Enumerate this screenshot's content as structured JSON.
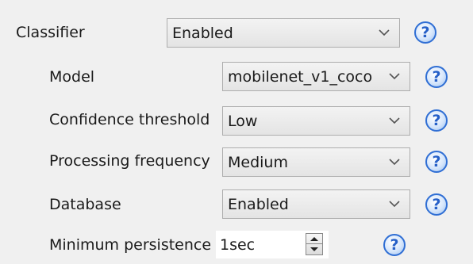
{
  "classifier": {
    "label": "Classifier",
    "value": "Enabled",
    "help": "?"
  },
  "model": {
    "label": "Model",
    "value": "mobilenet_v1_coco",
    "help": "?"
  },
  "confidence": {
    "label": "Confidence threshold",
    "value": "Low",
    "help": "?"
  },
  "frequency": {
    "label": "Processing frequency",
    "value": "Medium",
    "help": "?"
  },
  "database": {
    "label": "Database",
    "value": "Enabled",
    "help": "?"
  },
  "persistence": {
    "label": "Minimum persistence",
    "value": "1sec",
    "help": "?"
  },
  "icons": {
    "dropdown": "chevron-down-icon",
    "help": "help-icon",
    "spinner": "spinner-arrows-icon"
  },
  "colors": {
    "help_accent": "#2f6ed4",
    "background": "#f0f0f0"
  }
}
